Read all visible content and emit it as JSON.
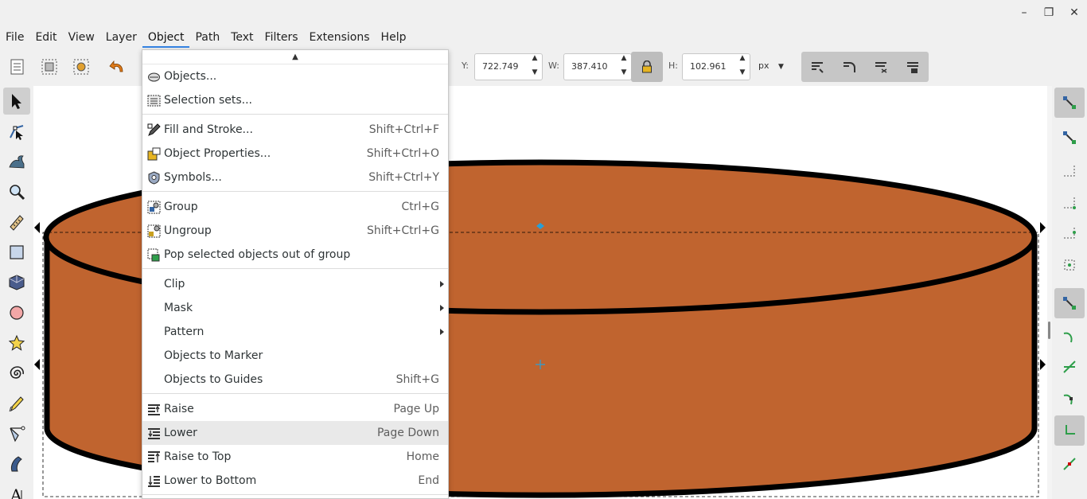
{
  "window": {
    "minimize": "–",
    "maximize": "❐",
    "close": "✕"
  },
  "menubar": [
    "File",
    "Edit",
    "View",
    "Layer",
    "Object",
    "Path",
    "Text",
    "Filters",
    "Extensions",
    "Help"
  ],
  "toolbar": {
    "y_label": "Y:",
    "y_value": "722.749",
    "w_label": "W:",
    "w_value": "387.410",
    "h_label": "H:",
    "h_value": "102.961",
    "unit": "px"
  },
  "menu": {
    "scroll_up": "▲",
    "items": [
      {
        "label": "Objects...",
        "shortcut": "",
        "icon": "objects-icon"
      },
      {
        "label": "Selection sets...",
        "shortcut": "",
        "icon": "selection-sets-icon"
      },
      {
        "label": "Fill and Stroke...",
        "shortcut": "Shift+Ctrl+F",
        "icon": "fill-stroke-icon"
      },
      {
        "label": "Object Properties...",
        "shortcut": "Shift+Ctrl+O",
        "icon": "object-properties-icon"
      },
      {
        "label": "Symbols...",
        "shortcut": "Shift+Ctrl+Y",
        "icon": "symbols-icon"
      },
      {
        "label": "Group",
        "shortcut": "Ctrl+G",
        "icon": "group-icon"
      },
      {
        "label": "Ungroup",
        "shortcut": "Shift+Ctrl+G",
        "icon": "ungroup-icon"
      },
      {
        "label": "Pop selected objects out of group",
        "shortcut": "",
        "icon": "pop-out-icon"
      },
      {
        "label": "Clip",
        "shortcut": "",
        "submenu": true
      },
      {
        "label": "Mask",
        "shortcut": "",
        "submenu": true
      },
      {
        "label": "Pattern",
        "shortcut": "",
        "submenu": true
      },
      {
        "label": "Objects to Marker",
        "shortcut": ""
      },
      {
        "label": "Objects to Guides",
        "shortcut": "Shift+G"
      },
      {
        "label": "Raise",
        "shortcut": "Page Up",
        "icon": "raise-icon"
      },
      {
        "label": "Lower",
        "shortcut": "Page Down",
        "icon": "lower-icon",
        "hover": true
      },
      {
        "label": "Raise to Top",
        "shortcut": "Home",
        "icon": "raise-top-icon"
      },
      {
        "label": "Lower to Bottom",
        "shortcut": "End",
        "icon": "lower-bottom-icon"
      }
    ]
  },
  "colors": {
    "fill": "#c0642f",
    "stroke": "#000000",
    "accent": "#3584e4",
    "handle": "#2a9fd6"
  },
  "tools": [
    "selector-tool-icon",
    "node-tool-icon",
    "tweak-tool-icon",
    "zoom-tool-icon",
    "measure-tool-icon",
    "rectangle-tool-icon",
    "3d-box-tool-icon",
    "ellipse-tool-icon",
    "star-tool-icon",
    "spiral-tool-icon",
    "pencil-tool-icon",
    "pen-tool-icon",
    "calligraphy-tool-icon",
    "text-tool-icon"
  ]
}
